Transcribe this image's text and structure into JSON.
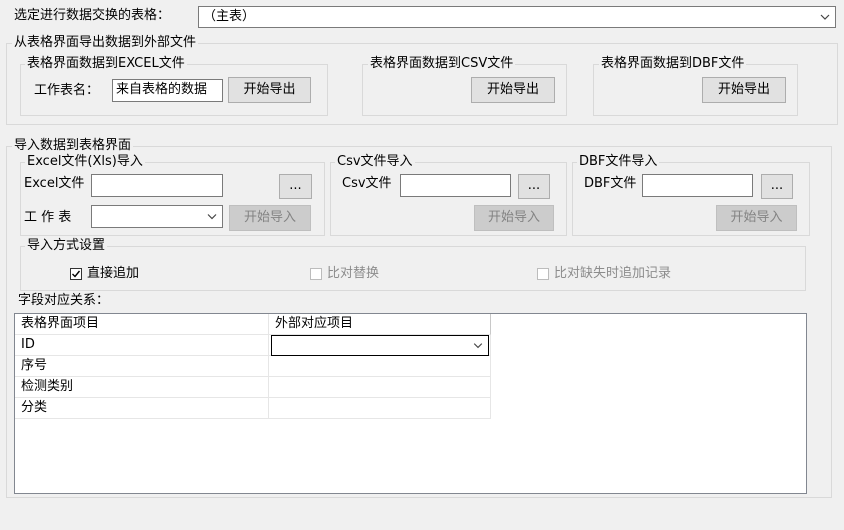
{
  "table_select": {
    "label": "选定进行数据交换的表格：",
    "value": "（主表）"
  },
  "export": {
    "title": "从表格界面导出数据到外部文件",
    "excel": {
      "title": "表格界面数据到EXCEL文件",
      "sheet_label": "工作表名：",
      "sheet_value": "来自表格的数据",
      "button": "开始导出"
    },
    "csv": {
      "title": "表格界面数据到CSV文件",
      "button": "开始导出"
    },
    "dbf": {
      "title": "表格界面数据到DBF文件",
      "button": "开始导出"
    }
  },
  "import": {
    "title": "导入数据到表格界面",
    "excel": {
      "title": "Excel文件(Xls)导入",
      "file_label": "Excel文件",
      "file_value": "",
      "browse": "...",
      "sheet_label": "工 作 表",
      "sheet_value": "",
      "button": "开始导入"
    },
    "csv": {
      "title": "Csv文件导入",
      "file_label": "Csv文件",
      "file_value": "",
      "browse": "...",
      "button": "开始导入"
    },
    "dbf": {
      "title": "DBF文件导入",
      "file_label": "DBF文件",
      "file_value": "",
      "browse": "...",
      "button": "开始导入"
    },
    "mode": {
      "title": "导入方式设置",
      "options": [
        {
          "label": "直接追加",
          "checked": true,
          "enabled": true
        },
        {
          "label": "比对替换",
          "checked": false,
          "enabled": false
        },
        {
          "label": "比对缺失时追加记录",
          "checked": false,
          "enabled": false
        }
      ]
    }
  },
  "mapping": {
    "label": "字段对应关系：",
    "columns": [
      "表格界面项目",
      "外部对应项目"
    ],
    "rows": [
      {
        "item": "ID",
        "external": ""
      },
      {
        "item": "序号",
        "external": ""
      },
      {
        "item": "检测类别",
        "external": ""
      },
      {
        "item": "分类",
        "external": ""
      }
    ]
  }
}
